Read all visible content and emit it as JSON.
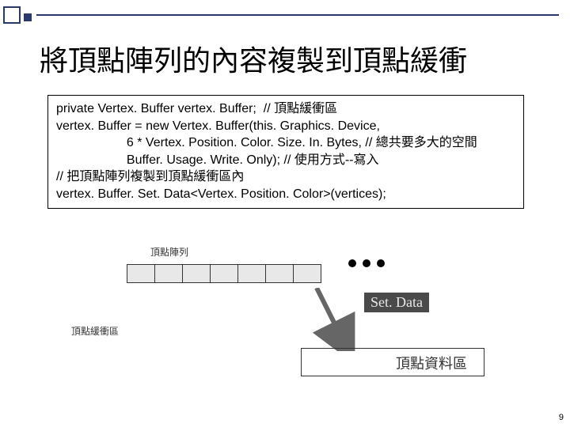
{
  "title": "將頂點陣列的內容複製到頂點緩衝",
  "code": {
    "l1": "private Vertex. Buffer vertex. Buffer;  // 頂點緩衝區",
    "l2": "vertex. Buffer = new Vertex. Buffer(this. Graphics. Device,",
    "l3": "                    6 * Vertex. Position. Color. Size. In. Bytes, // 總共要多大的空間",
    "l4": "                    Buffer. Usage. Write. Only); // 使用方式--寫入",
    "l5": "// 把頂點陣列複製到頂點緩衝區內",
    "l6": "vertex. Buffer. Set. Data<Vertex. Position. Color>(vertices);"
  },
  "diagram": {
    "array_label": "頂點陣列",
    "buffer_region_label": "頂點緩衝區",
    "arrow_label": "Set. Data",
    "data_area_label": "頂點資料區"
  },
  "page_number": "9"
}
